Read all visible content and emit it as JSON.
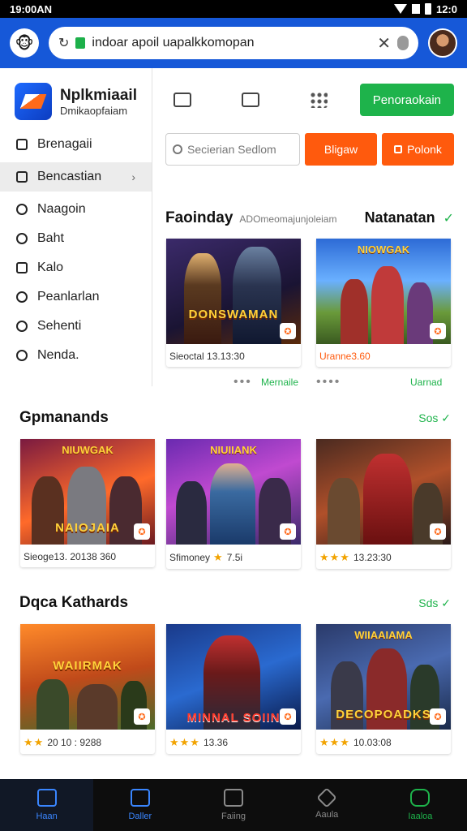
{
  "status": {
    "time_left": "19:00AN",
    "time_right": "12:0"
  },
  "browser": {
    "url": "indoar apoil  uapalkkomopan",
    "reload_glyph": "↻",
    "clear_glyph": "✕"
  },
  "sidebar": {
    "brand_name": "Nplkmiaail",
    "brand_sub": "Dmikaopfaiam",
    "items": [
      {
        "label": "Brenagaii"
      },
      {
        "label": "Bencastian",
        "chevron": "›"
      },
      {
        "label": "Naagoin"
      },
      {
        "label": "Baht"
      },
      {
        "label": "Kalo"
      },
      {
        "label": "Peanlarlan"
      },
      {
        "label": "Sehenti"
      },
      {
        "label": "Nenda."
      }
    ]
  },
  "toolbar": {
    "primary_button": "Penoraokain"
  },
  "search": {
    "placeholder": "Secierian    Sedlom",
    "btn1": "Bligaw",
    "btn2": "Polonk"
  },
  "featured": {
    "title": "Faoinday",
    "subtitle": "ADOmeomajunjoleiam",
    "link": "Natanatan",
    "check": "✓",
    "cards": [
      {
        "art": "DONSWAMAN",
        "meta": "Sieoctal 13.13:30",
        "foot_dots": "•••",
        "foot_link": "Mernaile"
      },
      {
        "art_top": "NIOWGAK",
        "meta": "Uranne3.60",
        "foot_dots": "••••",
        "foot_link": "Uarnad"
      }
    ]
  },
  "games": {
    "title": "Gpmanands",
    "link": "Sos ✓",
    "cards": [
      {
        "art_top": "NIUWGAK",
        "art": "NAIOJAIA",
        "meta": "Sieoge13. 20138 360"
      },
      {
        "art_top": "NIUIIANK",
        "meta": "Sfimoney",
        "stars": "★",
        "rating": "7.5i"
      },
      {
        "meta": "",
        "stars": "★★★",
        "rating": "13.23:30"
      }
    ]
  },
  "kathards": {
    "title": "Dqca Kathards",
    "link": "Sds ✓",
    "cards": [
      {
        "art": "WAIIRMAK",
        "stars": "★★",
        "rating": "20 10 : 9288"
      },
      {
        "art": "MINNAL SOIIN",
        "stars": "★★★",
        "rating": "13.36"
      },
      {
        "art_top": "WIIAAIAMA",
        "art": "DECOPOADKS",
        "stars": "★★★",
        "rating": "10.03:08"
      }
    ]
  },
  "tabs": [
    {
      "label": "Haan"
    },
    {
      "label": "Daller"
    },
    {
      "label": "Faiing"
    },
    {
      "label": "Aaula"
    },
    {
      "label": "Iaaloa"
    }
  ],
  "colors": {
    "brand_blue": "#1658d8",
    "accent_green": "#1eb34b",
    "accent_orange": "#ff5a0d"
  }
}
